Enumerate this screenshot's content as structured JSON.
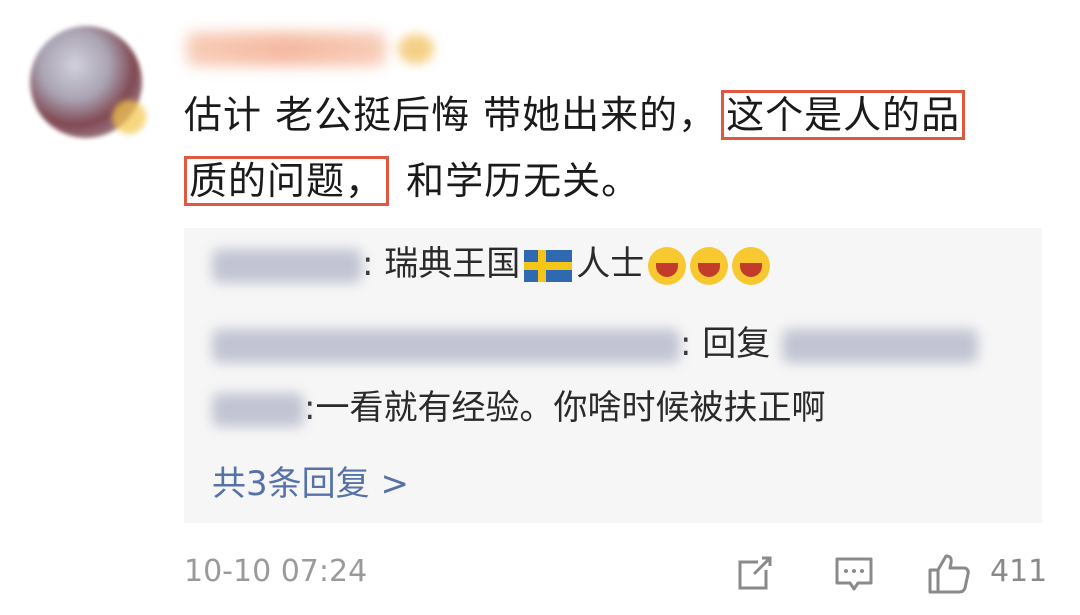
{
  "comment": {
    "text_before": "估计 老公挺后悔 带她出来的，",
    "highlight_1": "这个是人的品",
    "highlight_2": "质的问题，",
    "text_after": "和学历无关。"
  },
  "replies": [
    {
      "text": ": 瑞典王国",
      "text_2": "人士",
      "icons": [
        "sweden-flag-icon",
        "laughing-emoji-icon",
        "laughing-emoji-icon",
        "laughing-emoji-icon"
      ]
    },
    {
      "text": ": 回复"
    },
    {
      "text": ":一看就有经验。你啥时候被扶正啊"
    }
  ],
  "more_replies_label": "共3条回复 >",
  "footer": {
    "timestamp": "10-10 07:24",
    "like_count": "411"
  },
  "colors": {
    "highlight_border": "#e0583f",
    "link": "#5672a6",
    "reply_bg": "#f6f6f6"
  }
}
